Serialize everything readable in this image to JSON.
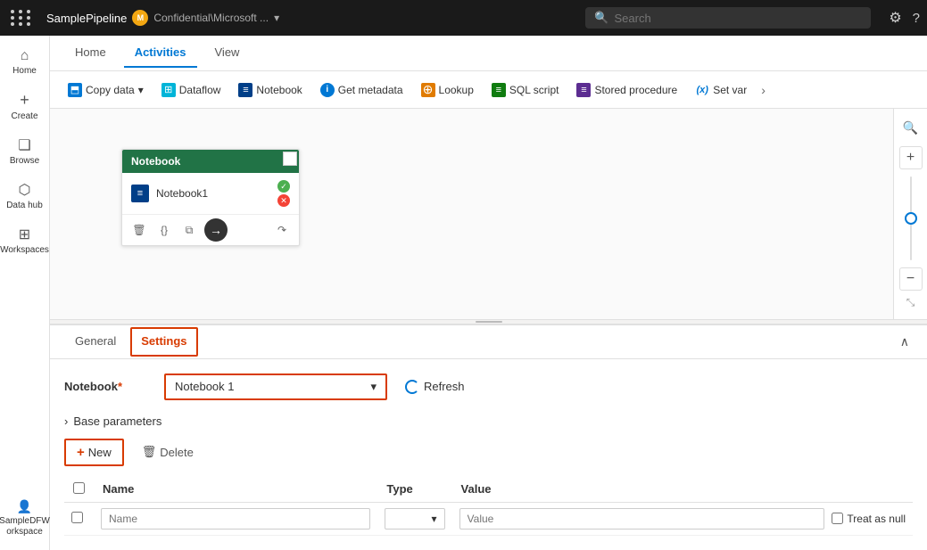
{
  "topbar": {
    "pipeline_name": "SamplePipeline",
    "workspace_label": "Confidential\\Microsoft ...",
    "search_placeholder": "Search",
    "settings_title": "Settings",
    "help_title": "Help"
  },
  "sidebar": {
    "items": [
      {
        "id": "home",
        "label": "Home",
        "icon": "⌂"
      },
      {
        "id": "create",
        "label": "Create",
        "icon": "+"
      },
      {
        "id": "browse",
        "label": "Browse",
        "icon": "❑"
      },
      {
        "id": "datahub",
        "label": "Data hub",
        "icon": "⬡"
      },
      {
        "id": "workspaces",
        "label": "Workspaces",
        "icon": "⊞"
      },
      {
        "id": "sampledfw",
        "label": "SampleDFW orkspace",
        "icon": "👤"
      }
    ]
  },
  "tabs": [
    {
      "id": "home",
      "label": "Home"
    },
    {
      "id": "activities",
      "label": "Activities"
    },
    {
      "id": "view",
      "label": "View"
    }
  ],
  "activity_bar": {
    "items": [
      {
        "id": "copy-data",
        "label": "Copy data",
        "icon": "⬒",
        "color": "blue",
        "hasDropdown": true
      },
      {
        "id": "dataflow",
        "label": "Dataflow",
        "icon": "⊞",
        "color": "teal"
      },
      {
        "id": "notebook",
        "label": "Notebook",
        "icon": "≡",
        "color": "darkblue"
      },
      {
        "id": "get-metadata",
        "label": "Get metadata",
        "icon": "i",
        "color": "info"
      },
      {
        "id": "lookup",
        "label": "Lookup",
        "icon": "⊕",
        "color": "orange"
      },
      {
        "id": "sql-script",
        "label": "SQL script",
        "icon": "≡",
        "color": "green"
      },
      {
        "id": "stored-procedure",
        "label": "Stored procedure",
        "icon": "≡",
        "color": "purple"
      },
      {
        "id": "set-var",
        "label": "Set var",
        "color": "var"
      }
    ],
    "more_icon": "›"
  },
  "canvas": {
    "node": {
      "title": "Notebook",
      "icon": "≡",
      "name": "Notebook1",
      "status_success": "✓",
      "status_fail": "✕",
      "actions": [
        "🗑",
        "{}",
        "⧉",
        "→",
        "↷"
      ]
    }
  },
  "settings": {
    "tabs": [
      {
        "id": "general",
        "label": "General"
      },
      {
        "id": "settings",
        "label": "Settings"
      }
    ],
    "active_tab": "Settings",
    "notebook_label": "Notebook",
    "notebook_required": "*",
    "notebook_value": "Notebook 1",
    "refresh_label": "Refresh",
    "base_parameters_label": "Base parameters",
    "new_button": "New",
    "delete_button": "Delete",
    "table": {
      "columns": [
        "Name",
        "Type",
        "Value"
      ],
      "row": {
        "name_placeholder": "Name",
        "type_placeholder": "",
        "value_placeholder": "Value",
        "treat_as_null": "Treat as null"
      }
    }
  }
}
